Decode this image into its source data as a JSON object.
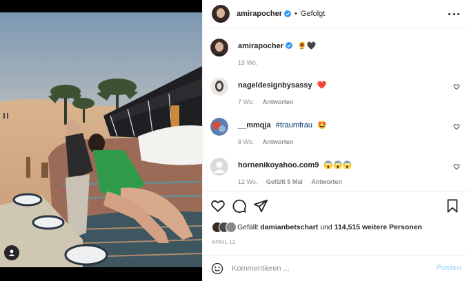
{
  "post": {
    "author": "amirapocher",
    "header_separator": "•",
    "follow_status": "Gefolgt",
    "caption_emoji": "🌻🖤",
    "caption_time": "15 Wo."
  },
  "comments": [
    {
      "user": "nageldesignbysassy",
      "text": "❤️",
      "hashtag": "",
      "time": "7 Wo.",
      "likes": "",
      "reply": "Antworten"
    },
    {
      "user": "__mmqja",
      "text": "",
      "hashtag": "#traumfrau",
      "emoji": "🤩",
      "time": "8 Wo.",
      "likes": "",
      "reply": "Antworten"
    },
    {
      "user": "hornenikoyahoo.com9",
      "text": "😱😱😱",
      "hashtag": "",
      "time": "12 Wo.",
      "likes": "Gefällt 5 Mal",
      "reply": "Antworten"
    }
  ],
  "likes": {
    "prefix": "Gefällt",
    "user": "damianbetschart",
    "connector": "und",
    "count": "114,515 weitere Personen"
  },
  "date": "APRIL 12",
  "comment_box": {
    "placeholder": "Kommentieren ...",
    "post_label": "Posten"
  },
  "icons": {
    "verified": "verified-badge-icon",
    "more": "more-options-icon",
    "like": "heart-icon",
    "comment": "comment-bubble-icon",
    "share": "paper-plane-icon",
    "save": "bookmark-icon",
    "emoji": "smiley-icon",
    "tag": "user-tag-icon"
  },
  "colors": {
    "verified": "#3897f0",
    "link": "#00376b",
    "secondary_text": "#8e8e8e",
    "post_button_disabled": "#b2dffc",
    "heart_red": "#ed4956"
  }
}
